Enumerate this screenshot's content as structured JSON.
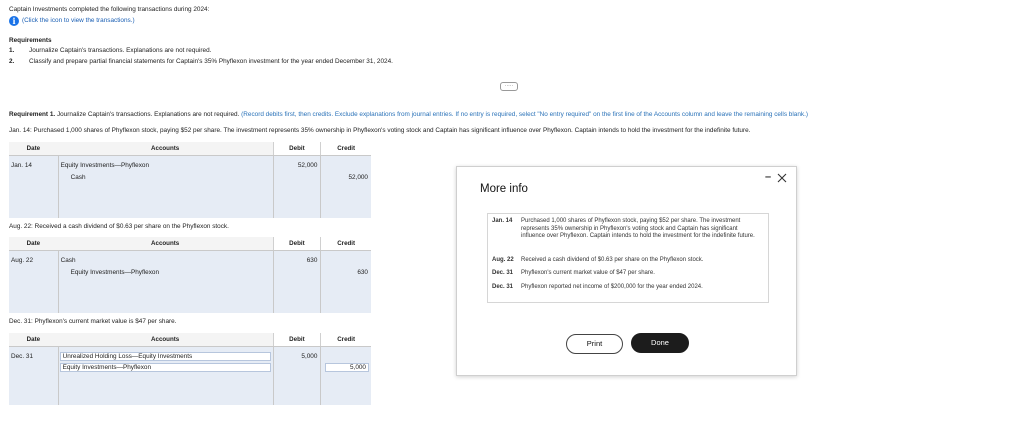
{
  "intro": "Captain Investments completed the following transactions during 2024:",
  "info_link": "(Click the icon to view the transactions.)",
  "requirements": {
    "title": "Requirements",
    "items": [
      {
        "num": "1.",
        "text": "Journalize Captain's transactions. Explanations are not required."
      },
      {
        "num": "2.",
        "text": "Classify and prepare partial financial statements for Captain's 35% Phyflexon investment for the year ended December 31, 2024."
      }
    ]
  },
  "divider_label": "·····",
  "req1": {
    "title": "Requirement 1.",
    "text": "Journalize Captain's transactions. Explanations are not required.",
    "hint": "(Record debits first, then credits. Exclude explanations from journal entries. If no entry is required, select \"No entry required\" on the first line of the Accounts column and leave the remaining cells blank.)"
  },
  "headers": {
    "date": "Date",
    "accounts": "Accounts",
    "debit": "Debit",
    "credit": "Credit"
  },
  "transactions": [
    {
      "label": "Jan. 14: Purchased 1,000 shares of Phyflexon stock, paying $52 per share. The investment represents 35% ownership in Phyflexon's voting stock and Captain has significant influence over Phyflexon. Captain intends to hold the investment for the indefinite future.",
      "date": "Jan. 14",
      "rows": [
        {
          "account": "Equity Investments—Phyflexon",
          "debit": "52,000",
          "credit": ""
        },
        {
          "account": "Cash",
          "debit": "",
          "credit": "52,000"
        }
      ]
    },
    {
      "label": "Aug. 22: Received a cash dividend of $0.63 per share on the Phyflexon stock.",
      "date": "Aug. 22",
      "rows": [
        {
          "account": "Cash",
          "debit": "630",
          "credit": ""
        },
        {
          "account": "Equity Investments—Phyflexon",
          "debit": "",
          "credit": "630"
        }
      ]
    },
    {
      "label": "Dec. 31: Phyflexon's current market value is $47 per share.",
      "date": "Dec. 31",
      "rows": [
        {
          "account": "Unrealized Holding Loss—Equity Investments",
          "debit": "5,000",
          "credit": ""
        },
        {
          "account": "Equity Investments—Phyflexon",
          "debit": "",
          "credit": "5,000"
        }
      ]
    }
  ],
  "modal": {
    "title": "More info",
    "minimize": "–",
    "entries": [
      {
        "date": "Jan. 14",
        "text": "Purchased 1,000 shares of Phyflexon stock, paying $52 per share. The investment represents 35% ownership in Phyflexon's voting stock and Captain has significant influence over Phyflexon. Captain intends to hold the investment for the indefinite future."
      },
      {
        "date": "Aug. 22",
        "text": "Received a cash dividend of $0.63 per share on the Phyflexon stock."
      },
      {
        "date": "Dec. 31",
        "text": "Phyflexon's current market value of $47 per share."
      },
      {
        "date": "Dec. 31",
        "text": "Phyflexon reported net income of $200,000 for the year ended 2024."
      }
    ],
    "print_label": "Print",
    "done_label": "Done"
  }
}
